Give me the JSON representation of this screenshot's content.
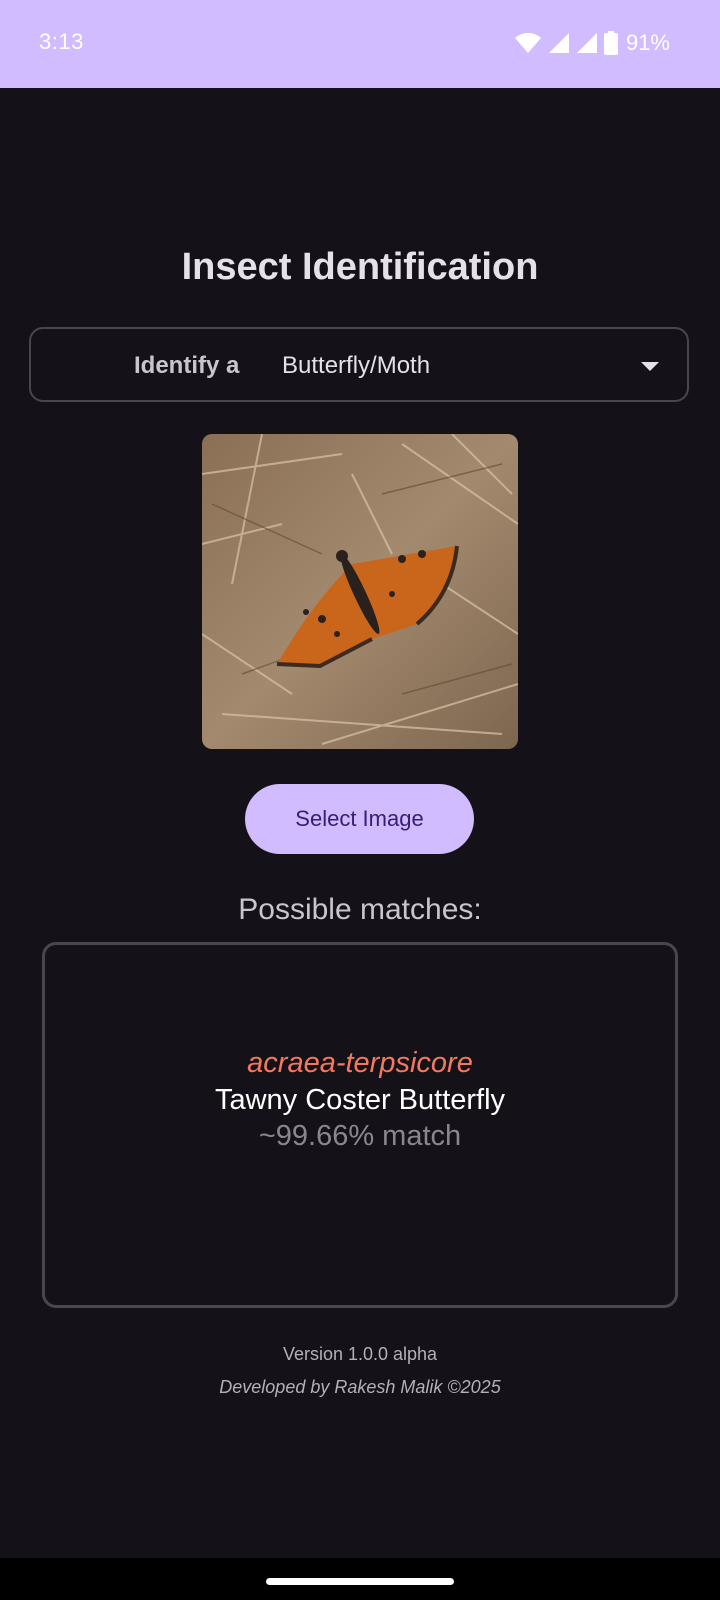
{
  "status_bar": {
    "time": "3:13",
    "battery_percent": "91%",
    "icons": [
      "wifi-icon",
      "signal-icon",
      "signal-icon",
      "battery-icon"
    ]
  },
  "title": "Insect Identification",
  "dropdown": {
    "label": "Identify a",
    "selected": "Butterfly/Moth"
  },
  "image": {
    "subject": "insect-photo"
  },
  "select_button": "Select Image",
  "matches_heading": "Possible matches:",
  "results": [
    {
      "scientific_name": "acraea-terpsicore",
      "common_name": "Tawny Coster Butterfly",
      "match": "~99.66% match"
    }
  ],
  "footer": {
    "version": "Version 1.0.0 alpha",
    "credit": "Developed by Rakesh Malik ©2025"
  },
  "colors": {
    "accent": "#D0BCFF",
    "background": "#141218",
    "scientific_name": "#F2795E"
  }
}
